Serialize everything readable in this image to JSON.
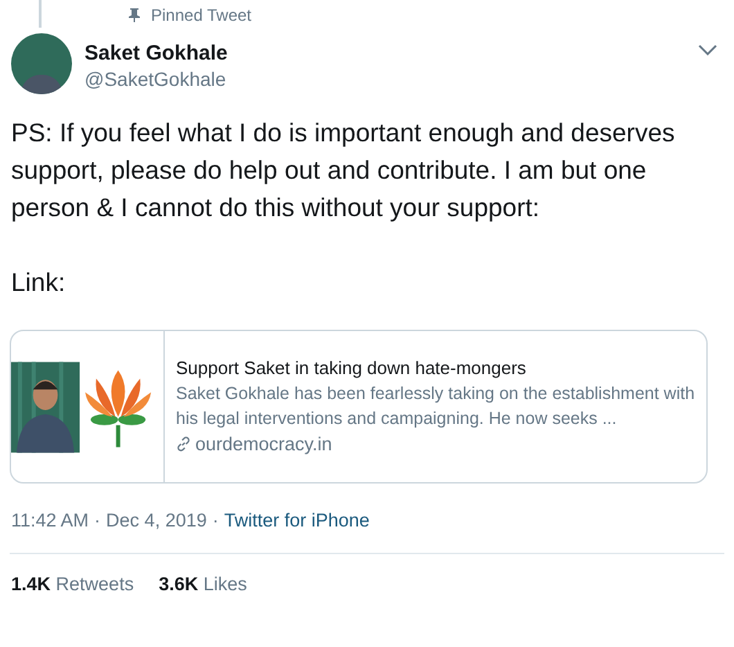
{
  "pinned_label": "Pinned Tweet",
  "author": {
    "name": "Saket Gokhale",
    "handle": "@SaketGokhale"
  },
  "body": [
    "PS: If you feel what I do is important enough and deserves support, please do help out and contribute. I am but one person & I cannot do this without your support:",
    "Link:"
  ],
  "card": {
    "title": "Support Saket in taking down hate-mongers",
    "description": "Saket Gokhale has been fearlessly taking on the establishment with his legal interventions and campaigning. He now seeks ...",
    "domain": "ourdemocracy.in"
  },
  "meta": {
    "time": "11:42 AM",
    "separator_1": "·",
    "date": "Dec 4, 2019",
    "separator_2": "·",
    "source": "Twitter for iPhone"
  },
  "stats": [
    {
      "count": "1.4K",
      "label": "Retweets"
    },
    {
      "count": "3.6K",
      "label": "Likes"
    }
  ]
}
